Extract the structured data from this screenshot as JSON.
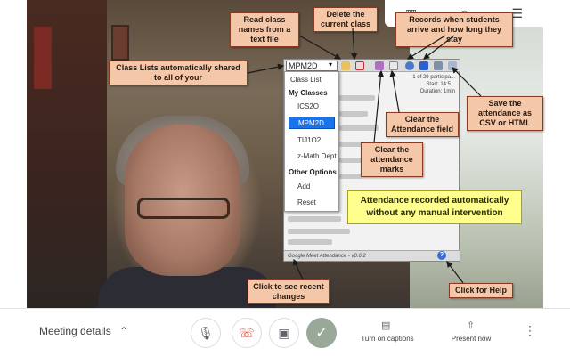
{
  "extension": {
    "class_select_value": "MPM2D",
    "participant_info": [
      "1 of 29 participa...",
      "Start: 14:5...",
      "Duration: 1min"
    ],
    "footer_text": "Google Meet Attendance - v0.6.2",
    "help_glyph": "?"
  },
  "dropdown": {
    "items": [
      "Class List",
      "My Classes",
      "ICS2O",
      "MPM2D",
      "TIJ1O2",
      "z-Math Dept",
      "Other Options",
      "Add",
      "Reset"
    ]
  },
  "callouts": {
    "read_names": "Read class names from a text file",
    "delete_class": "Delete the current class",
    "records_arrive": "Records when students arrive and how long they stay",
    "class_lists": "Class Lists automatically shared to all of your",
    "save_attendance": "Save the attendance as CSV or HTML",
    "clear_field": "Clear the Attendance field",
    "clear_marks": "Clear the attendance marks",
    "attendance_auto": "Attendance recorded automatically without any manual intervention",
    "recent_changes": "Click to see recent changes",
    "help": "Click for Help"
  },
  "bottom_bar": {
    "meeting_details": "Meeting details",
    "captions_label": "Turn on captions",
    "present_label": "Present now"
  },
  "colors": {
    "callout_bg": "#f4c7a8",
    "callout_border": "#8a3a20",
    "yellow_note": "#ffff8e",
    "selected_blue": "#1a73e8",
    "end_call_red": "#d93025"
  }
}
